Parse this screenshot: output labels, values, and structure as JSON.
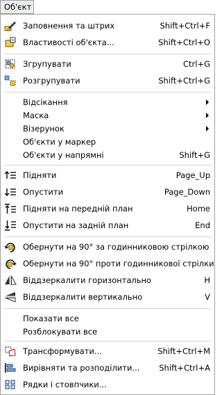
{
  "menubar": {
    "title": "Об'єкт"
  },
  "menu": {
    "items": [
      {
        "label": "Заповнення та штрих",
        "shortcut": "Shift+Ctrl+F",
        "icon": "fill-stroke-icon"
      },
      {
        "label": "Властивості об'єкта...",
        "shortcut": "Shift+Ctrl+O",
        "icon": "object-properties-icon"
      },
      {
        "label": "Згрупувати",
        "shortcut": "Ctrl+G",
        "icon": "group-icon"
      },
      {
        "label": "Розгрупувати",
        "shortcut": "Shift+Ctrl+G",
        "icon": "ungroup-icon"
      },
      {
        "label": "Відсікання",
        "shortcut": "",
        "icon": ""
      },
      {
        "label": "Маска",
        "shortcut": "",
        "icon": ""
      },
      {
        "label": "Візерунок",
        "shortcut": "",
        "icon": ""
      },
      {
        "label": "Об'єкти у маркер",
        "shortcut": "",
        "icon": ""
      },
      {
        "label": "Об'єкти у напрямні",
        "shortcut": "Shift+G",
        "icon": ""
      },
      {
        "label": "Підняти",
        "shortcut": "Page_Up",
        "icon": "raise-icon"
      },
      {
        "label": "Опустити",
        "shortcut": "Page_Down",
        "icon": "lower-icon"
      },
      {
        "label": "Підняти на передній план",
        "shortcut": "Home",
        "icon": "raise-to-top-icon"
      },
      {
        "label": "Опустити на задній план",
        "shortcut": "End",
        "icon": "lower-to-bottom-icon"
      },
      {
        "label": "Обернути на 90° за годинниковою стрілкою",
        "shortcut": "",
        "icon": "rotate-cw-icon"
      },
      {
        "label": "Обернути на 90° проти годинникової стрілки",
        "shortcut": "",
        "icon": "rotate-ccw-icon"
      },
      {
        "label": "Віддзеркалити горизонтально",
        "shortcut": "H",
        "icon": "flip-horizontal-icon"
      },
      {
        "label": "Віддзеркалити вертикально",
        "shortcut": "V",
        "icon": "flip-vertical-icon"
      },
      {
        "label": "Показати все",
        "shortcut": "",
        "icon": ""
      },
      {
        "label": "Розблокувати все",
        "shortcut": "",
        "icon": ""
      },
      {
        "label": "Трансформувати...",
        "shortcut": "Shift+Ctrl+M",
        "icon": "transform-icon"
      },
      {
        "label": "Вирівняти та розподілити...",
        "shortcut": "Shift+Ctrl+A",
        "icon": "align-distribute-icon"
      },
      {
        "label": "Рядки і стовпчики...",
        "shortcut": "",
        "icon": "rows-columns-icon"
      }
    ]
  }
}
